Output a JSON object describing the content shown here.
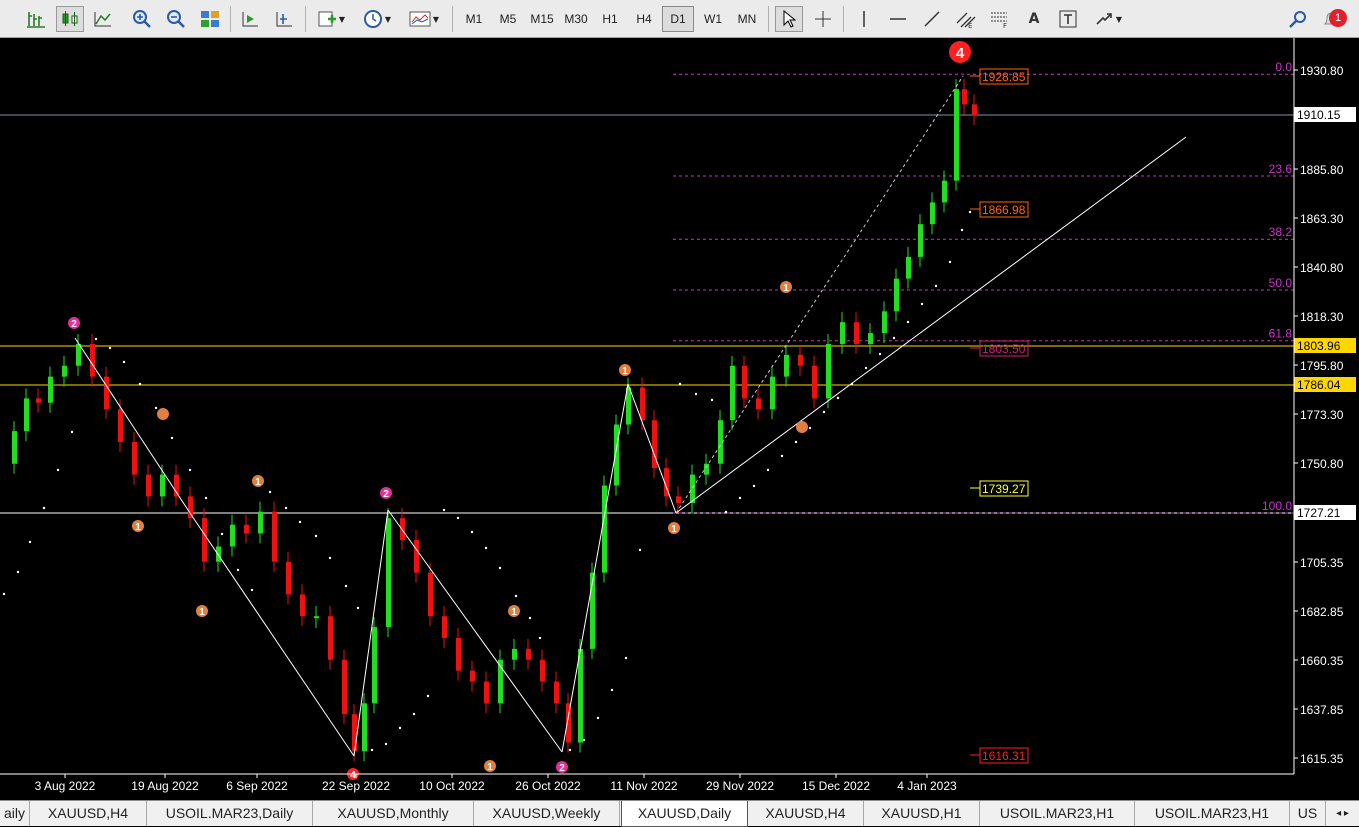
{
  "toolbar": {
    "timeframes": [
      "M1",
      "M5",
      "M15",
      "M30",
      "H1",
      "H4",
      "D1",
      "W1",
      "MN"
    ],
    "active_timeframe": "D1",
    "text_tool": "A",
    "notification_count": "1",
    "icons": [
      "bar-chart-icon",
      "candlestick-icon",
      "line-chart-icon",
      "zoom-in-icon",
      "zoom-out-icon",
      "tile-windows-icon",
      "autoscroll-icon",
      "chart-shift-icon",
      "new-order-icon",
      "clock-periods-icon",
      "templates-icon",
      "cursor-icon",
      "crosshair-icon",
      "vertical-line-icon",
      "horizontal-line-icon",
      "trendline-icon",
      "channels-icon",
      "fibonacci-icon",
      "text-icon",
      "text-label-icon",
      "shapes-icon",
      "search-icon",
      "alerts-icon"
    ]
  },
  "chart": {
    "symbol": "XAUUSD,Daily",
    "price_scale": [
      "1930.80",
      "1885.80",
      "1863.30",
      "1840.80",
      "1818.30",
      "1795.80",
      "1773.30",
      "1750.80",
      "1705.35",
      "1682.85",
      "1660.35",
      "1637.85",
      "1615.35"
    ],
    "price_tags": [
      {
        "label": "1910.15",
        "bg": "#ffffff",
        "fg": "#000000"
      },
      {
        "label": "1803.96",
        "bg": "#ffd700",
        "fg": "#000000"
      },
      {
        "label": "1786.04",
        "bg": "#ffd700",
        "fg": "#000000"
      },
      {
        "label": "1727.21",
        "bg": "#ffffff",
        "fg": "#000000"
      }
    ],
    "date_labels": [
      "3 Aug 2022",
      "19 Aug 2022",
      "6 Sep 2022",
      "22 Sep 2022",
      "10 Oct 2022",
      "26 Oct 2022",
      "11 Nov 2022",
      "29 Nov 2022",
      "15 Dec 2022",
      "4 Jan 2023"
    ],
    "fib_levels": [
      {
        "label": "0.0",
        "price": 1928.85
      },
      {
        "label": "23.6",
        "price": 1882.1
      },
      {
        "label": "38.2",
        "price": 1853.1
      },
      {
        "label": "50.0",
        "price": 1829.8
      },
      {
        "label": "61.8",
        "price": 1806.5
      },
      {
        "label": "100.0",
        "price": 1727.21
      }
    ],
    "boxed_labels": [
      {
        "text": "1928.85",
        "color": "#ff6600"
      },
      {
        "text": "1866.98",
        "color": "#ff6600"
      },
      {
        "text": "1803.50",
        "color": "#cc2277"
      },
      {
        "text": "1739.27",
        "color": "#ffff33"
      },
      {
        "text": "1616.31",
        "color": "#ff2020"
      }
    ],
    "wave_labels": [
      "2",
      "1",
      "1",
      "1",
      "2",
      "1",
      "2",
      "1",
      "1",
      "1",
      "1",
      "4",
      "4"
    ],
    "colors": {
      "bull": "#22dd22",
      "bear": "#ee1111",
      "fib": "#cc33cc",
      "grid": "#000000",
      "accent": "#ffd700"
    }
  },
  "tabs": [
    "aily",
    "XAUUSD,H4",
    "USOIL.MAR23,Daily",
    "XAUUSD,Monthly",
    "XAUUSD,Weekly",
    "XAUUSD,Daily",
    "XAUUSD,H4",
    "XAUUSD,H1",
    "USOIL.MAR23,H1",
    "USOIL.MAR23,H1",
    "US"
  ],
  "active_tab": "XAUUSD,Daily"
}
